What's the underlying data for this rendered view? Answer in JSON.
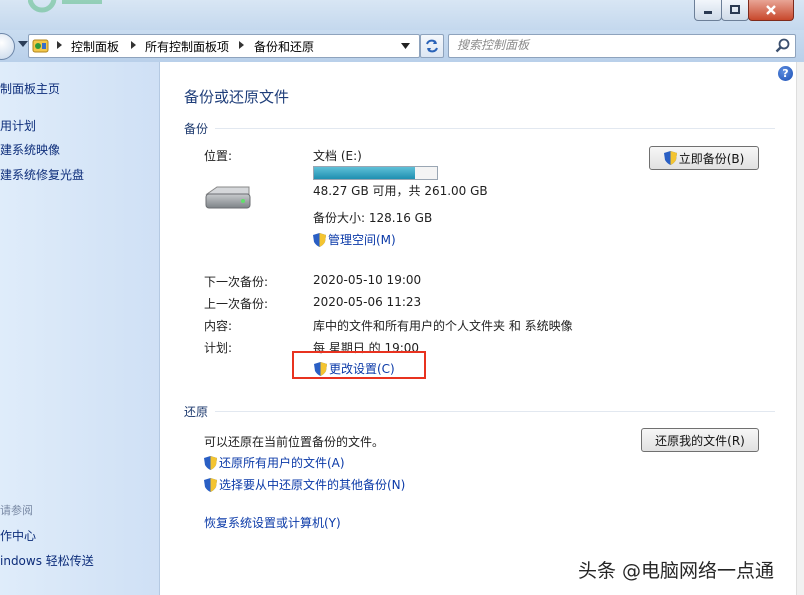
{
  "window": {
    "controls": [
      "minimize",
      "maximize",
      "close"
    ]
  },
  "address": {
    "crumbs": [
      "控制面板",
      "所有控制面板项",
      "备份和还原"
    ]
  },
  "search": {
    "placeholder": "搜索控制面板"
  },
  "sidebar": {
    "items": [
      "制面板主页",
      "用计划",
      "建系统映像",
      "建系统修复光盘"
    ],
    "see_also_title": "请参阅",
    "see_also": [
      "作中心",
      "indows 轻松传送"
    ]
  },
  "main": {
    "title": "备份或还原文件",
    "backup_section": "备份",
    "location_label": "位置:",
    "location_value": "文档 (E:)",
    "disk_usage_fraction": 0.82,
    "disk_free": "48.27 GB 可用，共 261.00 GB",
    "backup_size": "备份大小: 128.16 GB",
    "manage_space": "管理空间(M)",
    "backup_now": "立即备份(B)",
    "next_label": "下一次备份:",
    "next_value": "2020-05-10 19:00",
    "last_label": "上一次备份:",
    "last_value": "2020-05-06 11:23",
    "content_label": "内容:",
    "content_value": "库中的文件和所有用户的个人文件夹 和 系统映像",
    "schedule_label": "计划:",
    "schedule_value": "每 星期日 的 19:00",
    "change_settings": "更改设置(C)",
    "restore_section": "还原",
    "restore_text": "可以还原在当前位置备份的文件。",
    "restore_my_files": "还原我的文件(R)",
    "restore_all_users": "还原所有用户的文件(A)",
    "select_other_backup": "选择要从中还原文件的其他备份(N)",
    "recover_system": "恢复系统设置或计算机(Y)"
  },
  "watermark": "头条 @电脑网络一点通",
  "help_glyph": "?"
}
